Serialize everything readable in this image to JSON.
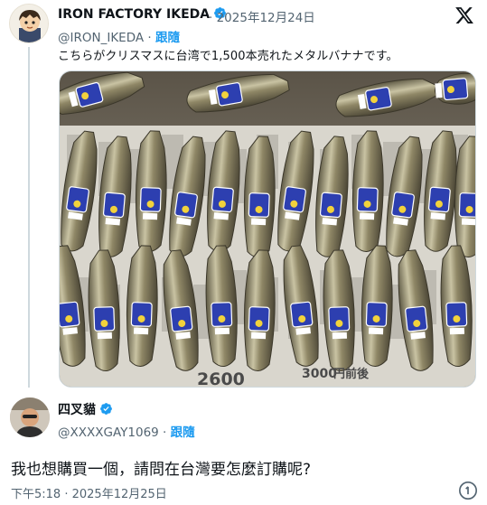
{
  "parent_tweet": {
    "display_name": "IRON FACTORY IKEDA",
    "date": "2025年12月24日",
    "handle": "@IRON_IKEDA",
    "follow_label": "跟隨",
    "text": "こちらがクリスマスに台湾で1,500本売れたメタルバナナです。",
    "image_alt": "metal-bananas-photo",
    "sticker_text": "Banana Natural DX",
    "newspaper_text": [
      "2600",
      "3000",
      "円前後"
    ]
  },
  "reply": {
    "display_name": "四叉貓",
    "handle": "@XXXXGAY1069",
    "follow_label": "跟隨",
    "text": "我也想購買一個，請問在台灣要怎麼訂購呢?",
    "time": "下午5:18",
    "date": "2025年12月25日"
  },
  "icons": {
    "verified": "verified-badge-icon",
    "platform": "x-logo-icon",
    "more": "more-options-icon"
  },
  "colors": {
    "link": "#1d9bf0",
    "muted": "#536471",
    "verified": "#1d9bf0"
  }
}
